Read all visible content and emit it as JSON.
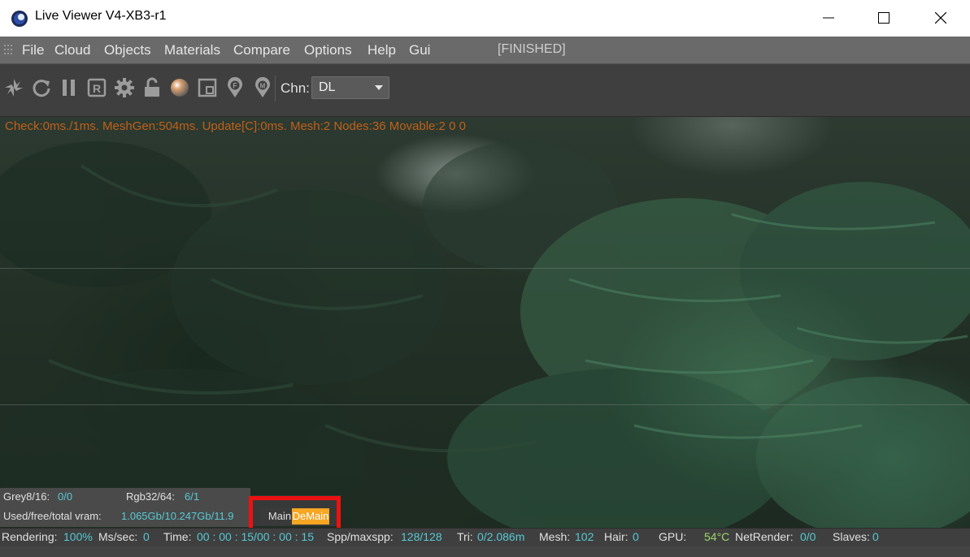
{
  "window": {
    "title": "Live Viewer V4-XB3-r1",
    "controls": [
      "minimize-icon",
      "maximize-icon",
      "close-icon"
    ]
  },
  "menu": {
    "items": [
      "File",
      "Cloud",
      "Objects",
      "Materials",
      "Compare",
      "Options",
      "Help",
      "Gui"
    ],
    "status": "[FINISHED]"
  },
  "toolbar": {
    "icons": [
      "aperture-icon",
      "refresh-icon",
      "pause-icon",
      "r-icon",
      "gear-icon",
      "lock-icon",
      "sphere-icon",
      "region-icon",
      "pin-f-icon",
      "pin-m-icon"
    ],
    "channel_label": "Chn:",
    "channel_value": "DL"
  },
  "viewport": {
    "stats_text": "Check:0ms./1ms. MeshGen:504ms. Update[C]:0ms. Mesh:2 Nodes:36 Movable:2  0 0"
  },
  "info": {
    "grey_label": "Grey8/16:",
    "grey_value": "0/0",
    "rgb_label": "Rgb32/64:",
    "rgb_value": "6/1",
    "vram_label": "Used/free/total vram:",
    "vram_value": "1.065Gb/10.247Gb/11.9"
  },
  "tabs": {
    "main": "Main",
    "demain": "DeMain",
    "active": "DeMain"
  },
  "status": {
    "rendering_label": "Rendering:",
    "rendering_value": "100%",
    "ms_label": "Ms/sec:",
    "ms_value": "0",
    "time_label": "Time:",
    "time_value": "00 : 00 : 15/00 : 00 : 15",
    "spp_label": "Spp/maxspp:",
    "spp_value": "128/128",
    "tri_label": "Tri:",
    "tri_value": "0/2.086m",
    "mesh_label": "Mesh:",
    "mesh_value": "102",
    "hair_label": "Hair:",
    "hair_value": "0",
    "gpu_label": "GPU:",
    "gpu_temp": "54°C",
    "netrender_label": "NetRender:",
    "netrender_value": "0/0",
    "slaves_label": "Slaves:",
    "slaves_value": "0"
  },
  "colors": {
    "highlight": "#ee1111",
    "active_tab": "#f5a623",
    "value_text": "#55c9d4",
    "stats_overlay": "#c2601a"
  }
}
